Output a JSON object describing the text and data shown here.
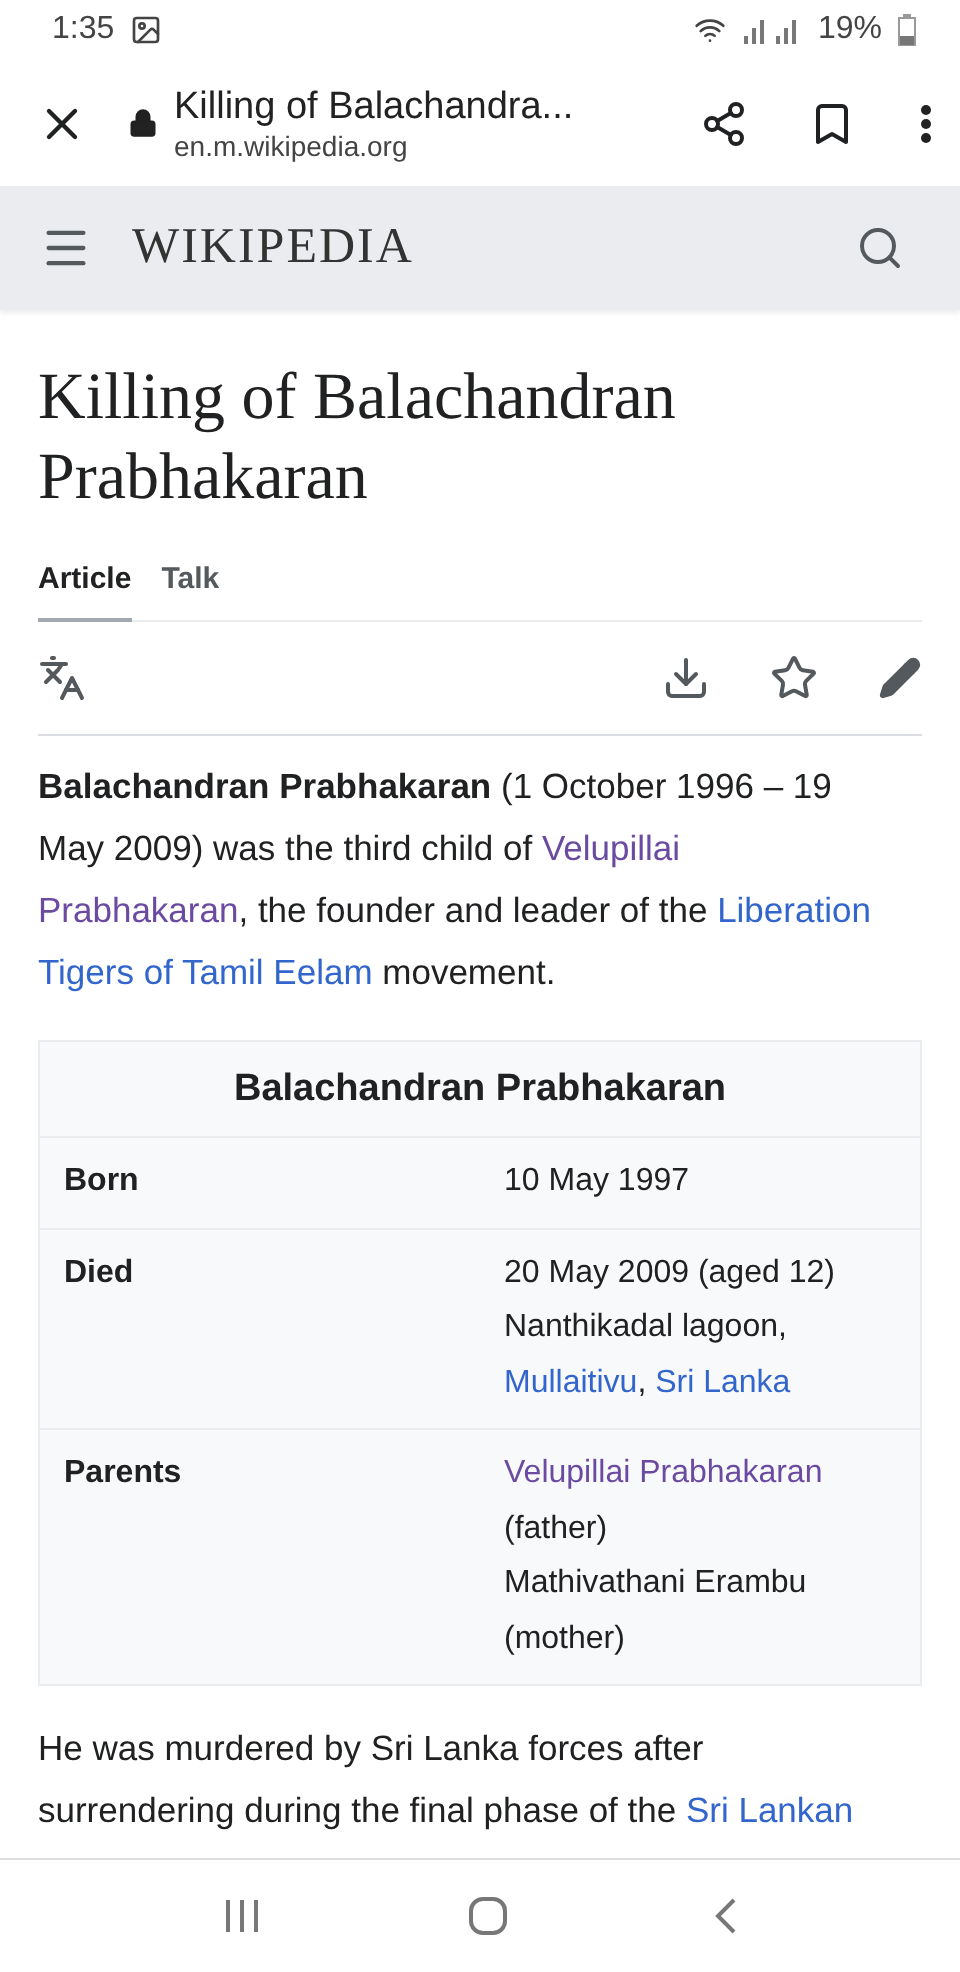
{
  "status_bar": {
    "time": "1:35",
    "battery": "19%"
  },
  "browser_bar": {
    "title": "Killing of Balachandra...",
    "url": "en.m.wikipedia.org"
  },
  "site_header": {
    "wordmark": "WIKIPEDIA"
  },
  "article": {
    "title": "Killing of Balachandran Prabhakaran",
    "tabs": [
      {
        "label": "Article",
        "selected": true
      },
      {
        "label": "Talk",
        "selected": false
      }
    ],
    "lead": [
      [
        {
          "kind": "bold",
          "text": "Balachandran Prabhakaran"
        },
        {
          "kind": "plain",
          "text": " (1 October 1996 – 19"
        }
      ],
      [
        {
          "kind": "plain",
          "text": "May 2009) was the third child of "
        },
        {
          "kind": "link",
          "visited": true,
          "text": "Velupillai"
        }
      ],
      [
        {
          "kind": "link",
          "visited": true,
          "text": "Prabhakaran"
        },
        {
          "kind": "plain",
          "text": ", the founder and leader of the "
        },
        {
          "kind": "link",
          "visited": false,
          "text": "Liberation"
        }
      ],
      [
        {
          "kind": "link",
          "visited": false,
          "text": "Tigers of Tamil Eelam"
        },
        {
          "kind": "plain",
          "text": " movement."
        }
      ]
    ],
    "infobox": {
      "title": "Balachandran Prabhakaran",
      "rows": [
        {
          "label": "Born",
          "lines": [
            [
              {
                "kind": "plain",
                "text": "10 May 1997"
              }
            ]
          ]
        },
        {
          "label": "Died",
          "lines": [
            [
              {
                "kind": "plain",
                "text": "20 May 2009 (aged 12)"
              }
            ],
            [
              {
                "kind": "plain",
                "text": "Nanthikadal lagoon,"
              }
            ],
            [
              {
                "kind": "link",
                "visited": false,
                "text": "Mullaitivu"
              },
              {
                "kind": "plain",
                "text": ", "
              },
              {
                "kind": "link",
                "visited": false,
                "text": "Sri Lanka"
              }
            ]
          ]
        },
        {
          "label": "Parents",
          "lines": [
            [
              {
                "kind": "link",
                "visited": true,
                "text": "Velupillai Prabhakaran"
              }
            ],
            [
              {
                "kind": "plain",
                "text": "(father)"
              }
            ],
            [
              {
                "kind": "plain",
                "text": "Mathivathani Erambu"
              }
            ],
            [
              {
                "kind": "plain",
                "text": "(mother)"
              }
            ]
          ]
        }
      ]
    },
    "body": [
      [
        {
          "kind": "plain",
          "text": "He was murdered by Sri Lanka forces after"
        }
      ],
      [
        {
          "kind": "plain",
          "text": "surrendering during the final phase of the "
        },
        {
          "kind": "link",
          "visited": false,
          "text": "Sri Lankan"
        }
      ]
    ]
  }
}
